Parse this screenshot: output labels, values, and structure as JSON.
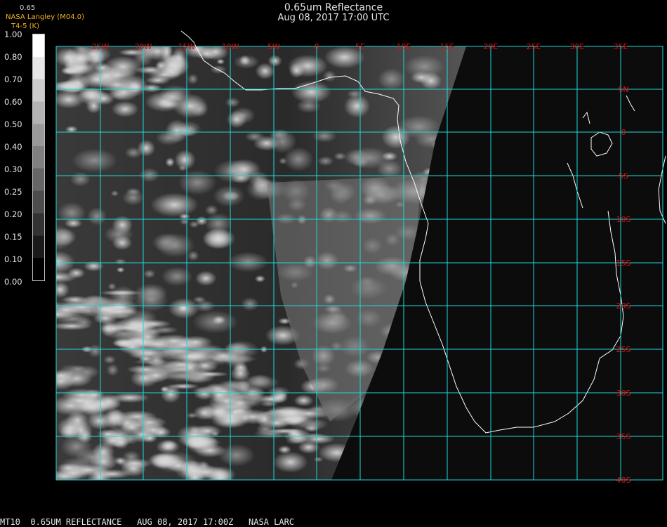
{
  "header": {
    "title": "0.65um Reflectance",
    "subtitle": "Aug 08, 2017 17:00 UTC",
    "credit_line1": "NASA Langley (M04.0)",
    "credit_line2": "T4-5 (K)",
    "credit_overlap": "0.65"
  },
  "colorbar": {
    "labels": [
      "1.00",
      "0.80",
      "0.70",
      "0.60",
      "0.50",
      "0.40",
      "0.30",
      "0.25",
      "0.20",
      "0.15",
      "0.10",
      "0.00"
    ],
    "min_color": "#000000",
    "max_color": "#ffffff"
  },
  "map": {
    "grid_color": "#20d8d8",
    "label_color": "#dd1010",
    "lon_labels": [
      "25W",
      "20W",
      "15W",
      "10W",
      "5W",
      "0",
      "5E",
      "10E",
      "15E",
      "20E",
      "25E",
      "30E",
      "35E"
    ],
    "lat_labels": [
      "5N",
      "0",
      "5S",
      "10S",
      "15S",
      "20S",
      "25S",
      "30S",
      "35S",
      "40S"
    ],
    "coast_color": "#ffffff",
    "imagery": "visible reflectance, daylight west of terminator, dark east"
  },
  "footer": {
    "text": "MT10  0.65UM REFLECTANCE   AUG 08, 2017 17:00Z   NASA LARC"
  }
}
